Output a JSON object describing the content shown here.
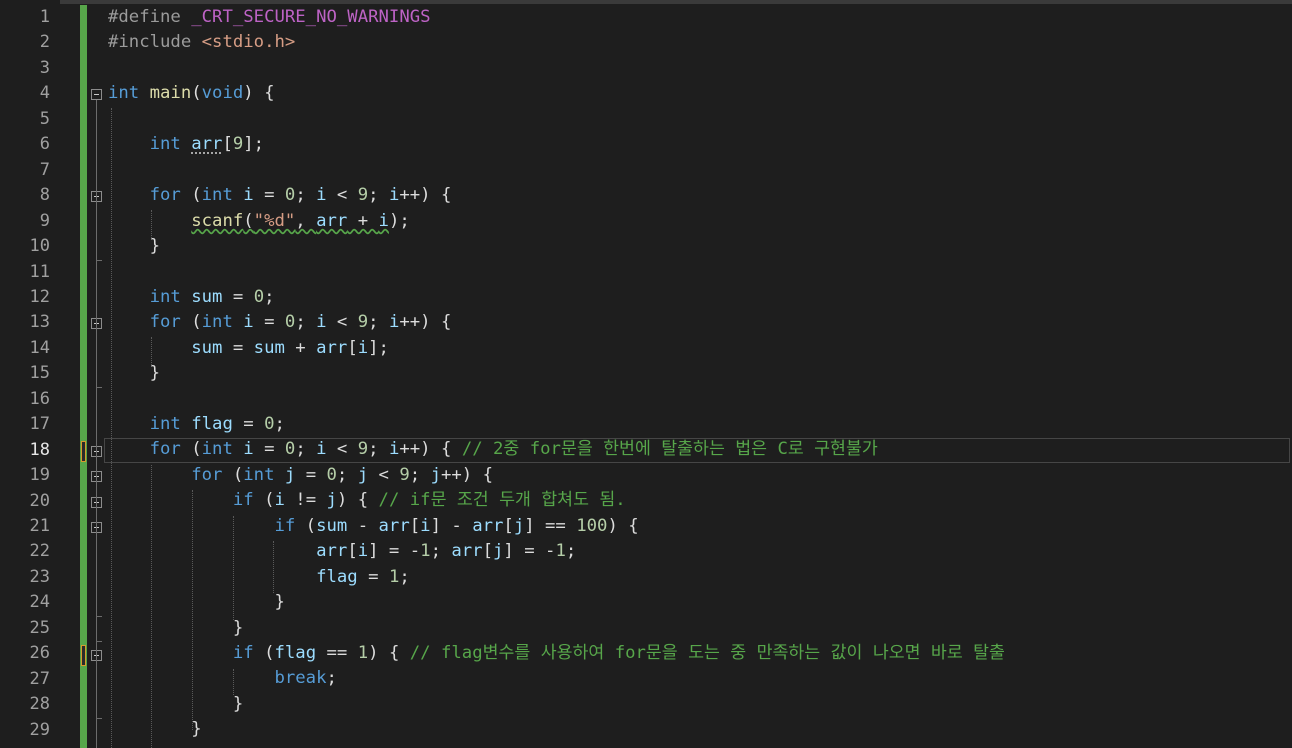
{
  "editor": {
    "current_line": 18,
    "lines": [
      {
        "n": "1",
        "tokens": [
          {
            "c": "pp",
            "t": "#define "
          },
          {
            "c": "mac",
            "t": "_CRT_SECURE_NO_WARNINGS"
          }
        ]
      },
      {
        "n": "2",
        "tokens": [
          {
            "c": "pp",
            "t": "#include "
          },
          {
            "c": "str",
            "t": "<stdio.h>"
          }
        ]
      },
      {
        "n": "3",
        "tokens": []
      },
      {
        "n": "4",
        "tokens": [
          {
            "c": "kw",
            "t": "int"
          },
          {
            "c": "txt",
            "t": " "
          },
          {
            "c": "fn",
            "t": "main"
          },
          {
            "c": "txt",
            "t": "("
          },
          {
            "c": "kw",
            "t": "void"
          },
          {
            "c": "txt",
            "t": ") {"
          }
        ]
      },
      {
        "n": "5",
        "tokens": []
      },
      {
        "n": "6",
        "tokens": [
          {
            "c": "txt",
            "t": "    "
          },
          {
            "c": "kw",
            "t": "int"
          },
          {
            "c": "txt",
            "t": " "
          },
          {
            "c": "var dotted",
            "t": "arr"
          },
          {
            "c": "txt",
            "t": "["
          },
          {
            "c": "num",
            "t": "9"
          },
          {
            "c": "txt",
            "t": "];"
          }
        ]
      },
      {
        "n": "7",
        "tokens": []
      },
      {
        "n": "8",
        "tokens": [
          {
            "c": "txt",
            "t": "    "
          },
          {
            "c": "kw",
            "t": "for"
          },
          {
            "c": "txt",
            "t": " ("
          },
          {
            "c": "kw",
            "t": "int"
          },
          {
            "c": "txt",
            "t": " "
          },
          {
            "c": "var",
            "t": "i"
          },
          {
            "c": "txt",
            "t": " = "
          },
          {
            "c": "num",
            "t": "0"
          },
          {
            "c": "txt",
            "t": "; "
          },
          {
            "c": "var",
            "t": "i"
          },
          {
            "c": "txt",
            "t": " < "
          },
          {
            "c": "num",
            "t": "9"
          },
          {
            "c": "txt",
            "t": "; "
          },
          {
            "c": "var",
            "t": "i"
          },
          {
            "c": "txt",
            "t": "++) {"
          }
        ]
      },
      {
        "n": "9",
        "tokens": [
          {
            "c": "txt",
            "t": "        "
          },
          {
            "c": "fn squig",
            "t": "scanf"
          },
          {
            "c": "txt squig",
            "t": "("
          },
          {
            "c": "str squig",
            "t": "\"%d\""
          },
          {
            "c": "txt squig",
            "t": ", "
          },
          {
            "c": "var squig",
            "t": "arr"
          },
          {
            "c": "txt squig",
            "t": " + "
          },
          {
            "c": "var squig",
            "t": "i"
          },
          {
            "c": "txt",
            "t": ");"
          }
        ]
      },
      {
        "n": "10",
        "tokens": [
          {
            "c": "txt",
            "t": "    }"
          }
        ]
      },
      {
        "n": "11",
        "tokens": []
      },
      {
        "n": "12",
        "tokens": [
          {
            "c": "txt",
            "t": "    "
          },
          {
            "c": "kw",
            "t": "int"
          },
          {
            "c": "txt",
            "t": " "
          },
          {
            "c": "var",
            "t": "sum"
          },
          {
            "c": "txt",
            "t": " = "
          },
          {
            "c": "num",
            "t": "0"
          },
          {
            "c": "txt",
            "t": ";"
          }
        ]
      },
      {
        "n": "13",
        "tokens": [
          {
            "c": "txt",
            "t": "    "
          },
          {
            "c": "kw",
            "t": "for"
          },
          {
            "c": "txt",
            "t": " ("
          },
          {
            "c": "kw",
            "t": "int"
          },
          {
            "c": "txt",
            "t": " "
          },
          {
            "c": "var",
            "t": "i"
          },
          {
            "c": "txt",
            "t": " = "
          },
          {
            "c": "num",
            "t": "0"
          },
          {
            "c": "txt",
            "t": "; "
          },
          {
            "c": "var",
            "t": "i"
          },
          {
            "c": "txt",
            "t": " < "
          },
          {
            "c": "num",
            "t": "9"
          },
          {
            "c": "txt",
            "t": "; "
          },
          {
            "c": "var",
            "t": "i"
          },
          {
            "c": "txt",
            "t": "++) {"
          }
        ]
      },
      {
        "n": "14",
        "tokens": [
          {
            "c": "txt",
            "t": "        "
          },
          {
            "c": "var",
            "t": "sum"
          },
          {
            "c": "txt",
            "t": " = "
          },
          {
            "c": "var",
            "t": "sum"
          },
          {
            "c": "txt",
            "t": " + "
          },
          {
            "c": "var",
            "t": "arr"
          },
          {
            "c": "txt",
            "t": "["
          },
          {
            "c": "var",
            "t": "i"
          },
          {
            "c": "txt",
            "t": "];"
          }
        ]
      },
      {
        "n": "15",
        "tokens": [
          {
            "c": "txt",
            "t": "    }"
          }
        ]
      },
      {
        "n": "16",
        "tokens": []
      },
      {
        "n": "17",
        "tokens": [
          {
            "c": "txt",
            "t": "    "
          },
          {
            "c": "kw",
            "t": "int"
          },
          {
            "c": "txt",
            "t": " "
          },
          {
            "c": "var",
            "t": "flag"
          },
          {
            "c": "txt",
            "t": " = "
          },
          {
            "c": "num",
            "t": "0"
          },
          {
            "c": "txt",
            "t": ";"
          }
        ]
      },
      {
        "n": "18",
        "tokens": [
          {
            "c": "txt",
            "t": "    "
          },
          {
            "c": "kw",
            "t": "for"
          },
          {
            "c": "txt",
            "t": " ("
          },
          {
            "c": "kw",
            "t": "int"
          },
          {
            "c": "txt",
            "t": " "
          },
          {
            "c": "var",
            "t": "i"
          },
          {
            "c": "txt",
            "t": " = "
          },
          {
            "c": "num",
            "t": "0"
          },
          {
            "c": "txt",
            "t": "; "
          },
          {
            "c": "var",
            "t": "i"
          },
          {
            "c": "txt",
            "t": " < "
          },
          {
            "c": "num",
            "t": "9"
          },
          {
            "c": "txt",
            "t": "; "
          },
          {
            "c": "var",
            "t": "i"
          },
          {
            "c": "txt",
            "t": "++) { "
          },
          {
            "c": "cmt",
            "t": "// 2중 for문을 한번에 탈출하는 법은 C로 구현불가"
          }
        ]
      },
      {
        "n": "19",
        "tokens": [
          {
            "c": "txt",
            "t": "        "
          },
          {
            "c": "kw",
            "t": "for"
          },
          {
            "c": "txt",
            "t": " ("
          },
          {
            "c": "kw",
            "t": "int"
          },
          {
            "c": "txt",
            "t": " "
          },
          {
            "c": "var",
            "t": "j"
          },
          {
            "c": "txt",
            "t": " = "
          },
          {
            "c": "num",
            "t": "0"
          },
          {
            "c": "txt",
            "t": "; "
          },
          {
            "c": "var",
            "t": "j"
          },
          {
            "c": "txt",
            "t": " < "
          },
          {
            "c": "num",
            "t": "9"
          },
          {
            "c": "txt",
            "t": "; "
          },
          {
            "c": "var",
            "t": "j"
          },
          {
            "c": "txt",
            "t": "++) {"
          }
        ]
      },
      {
        "n": "20",
        "tokens": [
          {
            "c": "txt",
            "t": "            "
          },
          {
            "c": "kw",
            "t": "if"
          },
          {
            "c": "txt",
            "t": " ("
          },
          {
            "c": "var",
            "t": "i"
          },
          {
            "c": "txt",
            "t": " != "
          },
          {
            "c": "var",
            "t": "j"
          },
          {
            "c": "txt",
            "t": ") { "
          },
          {
            "c": "cmt",
            "t": "// if문 조건 두개 합쳐도 됨."
          }
        ]
      },
      {
        "n": "21",
        "tokens": [
          {
            "c": "txt",
            "t": "                "
          },
          {
            "c": "kw",
            "t": "if"
          },
          {
            "c": "txt",
            "t": " ("
          },
          {
            "c": "var",
            "t": "sum"
          },
          {
            "c": "txt",
            "t": " - "
          },
          {
            "c": "var",
            "t": "arr"
          },
          {
            "c": "txt",
            "t": "["
          },
          {
            "c": "var",
            "t": "i"
          },
          {
            "c": "txt",
            "t": "] - "
          },
          {
            "c": "var",
            "t": "arr"
          },
          {
            "c": "txt",
            "t": "["
          },
          {
            "c": "var",
            "t": "j"
          },
          {
            "c": "txt",
            "t": "] == "
          },
          {
            "c": "num",
            "t": "100"
          },
          {
            "c": "txt",
            "t": ") {"
          }
        ]
      },
      {
        "n": "22",
        "tokens": [
          {
            "c": "txt",
            "t": "                    "
          },
          {
            "c": "var",
            "t": "arr"
          },
          {
            "c": "txt",
            "t": "["
          },
          {
            "c": "var",
            "t": "i"
          },
          {
            "c": "txt",
            "t": "] = -"
          },
          {
            "c": "num",
            "t": "1"
          },
          {
            "c": "txt",
            "t": "; "
          },
          {
            "c": "var",
            "t": "arr"
          },
          {
            "c": "txt",
            "t": "["
          },
          {
            "c": "var",
            "t": "j"
          },
          {
            "c": "txt",
            "t": "] = -"
          },
          {
            "c": "num",
            "t": "1"
          },
          {
            "c": "txt",
            "t": ";"
          }
        ]
      },
      {
        "n": "23",
        "tokens": [
          {
            "c": "txt",
            "t": "                    "
          },
          {
            "c": "var",
            "t": "flag"
          },
          {
            "c": "txt",
            "t": " = "
          },
          {
            "c": "num",
            "t": "1"
          },
          {
            "c": "txt",
            "t": ";"
          }
        ]
      },
      {
        "n": "24",
        "tokens": [
          {
            "c": "txt",
            "t": "                }"
          }
        ]
      },
      {
        "n": "25",
        "tokens": [
          {
            "c": "txt",
            "t": "            }"
          }
        ]
      },
      {
        "n": "26",
        "tokens": [
          {
            "c": "txt",
            "t": "            "
          },
          {
            "c": "kw",
            "t": "if"
          },
          {
            "c": "txt",
            "t": " ("
          },
          {
            "c": "var",
            "t": "flag"
          },
          {
            "c": "txt",
            "t": " == "
          },
          {
            "c": "num",
            "t": "1"
          },
          {
            "c": "txt",
            "t": ") { "
          },
          {
            "c": "cmt",
            "t": "// flag변수를 사용하여 for문을 도는 중 만족하는 값이 나오면 바로 탈출"
          }
        ]
      },
      {
        "n": "27",
        "tokens": [
          {
            "c": "txt",
            "t": "                "
          },
          {
            "c": "kw",
            "t": "break"
          },
          {
            "c": "txt",
            "t": ";"
          }
        ]
      },
      {
        "n": "28",
        "tokens": [
          {
            "c": "txt",
            "t": "            }"
          }
        ]
      },
      {
        "n": "29",
        "tokens": [
          {
            "c": "txt",
            "t": "        }"
          }
        ]
      }
    ]
  }
}
